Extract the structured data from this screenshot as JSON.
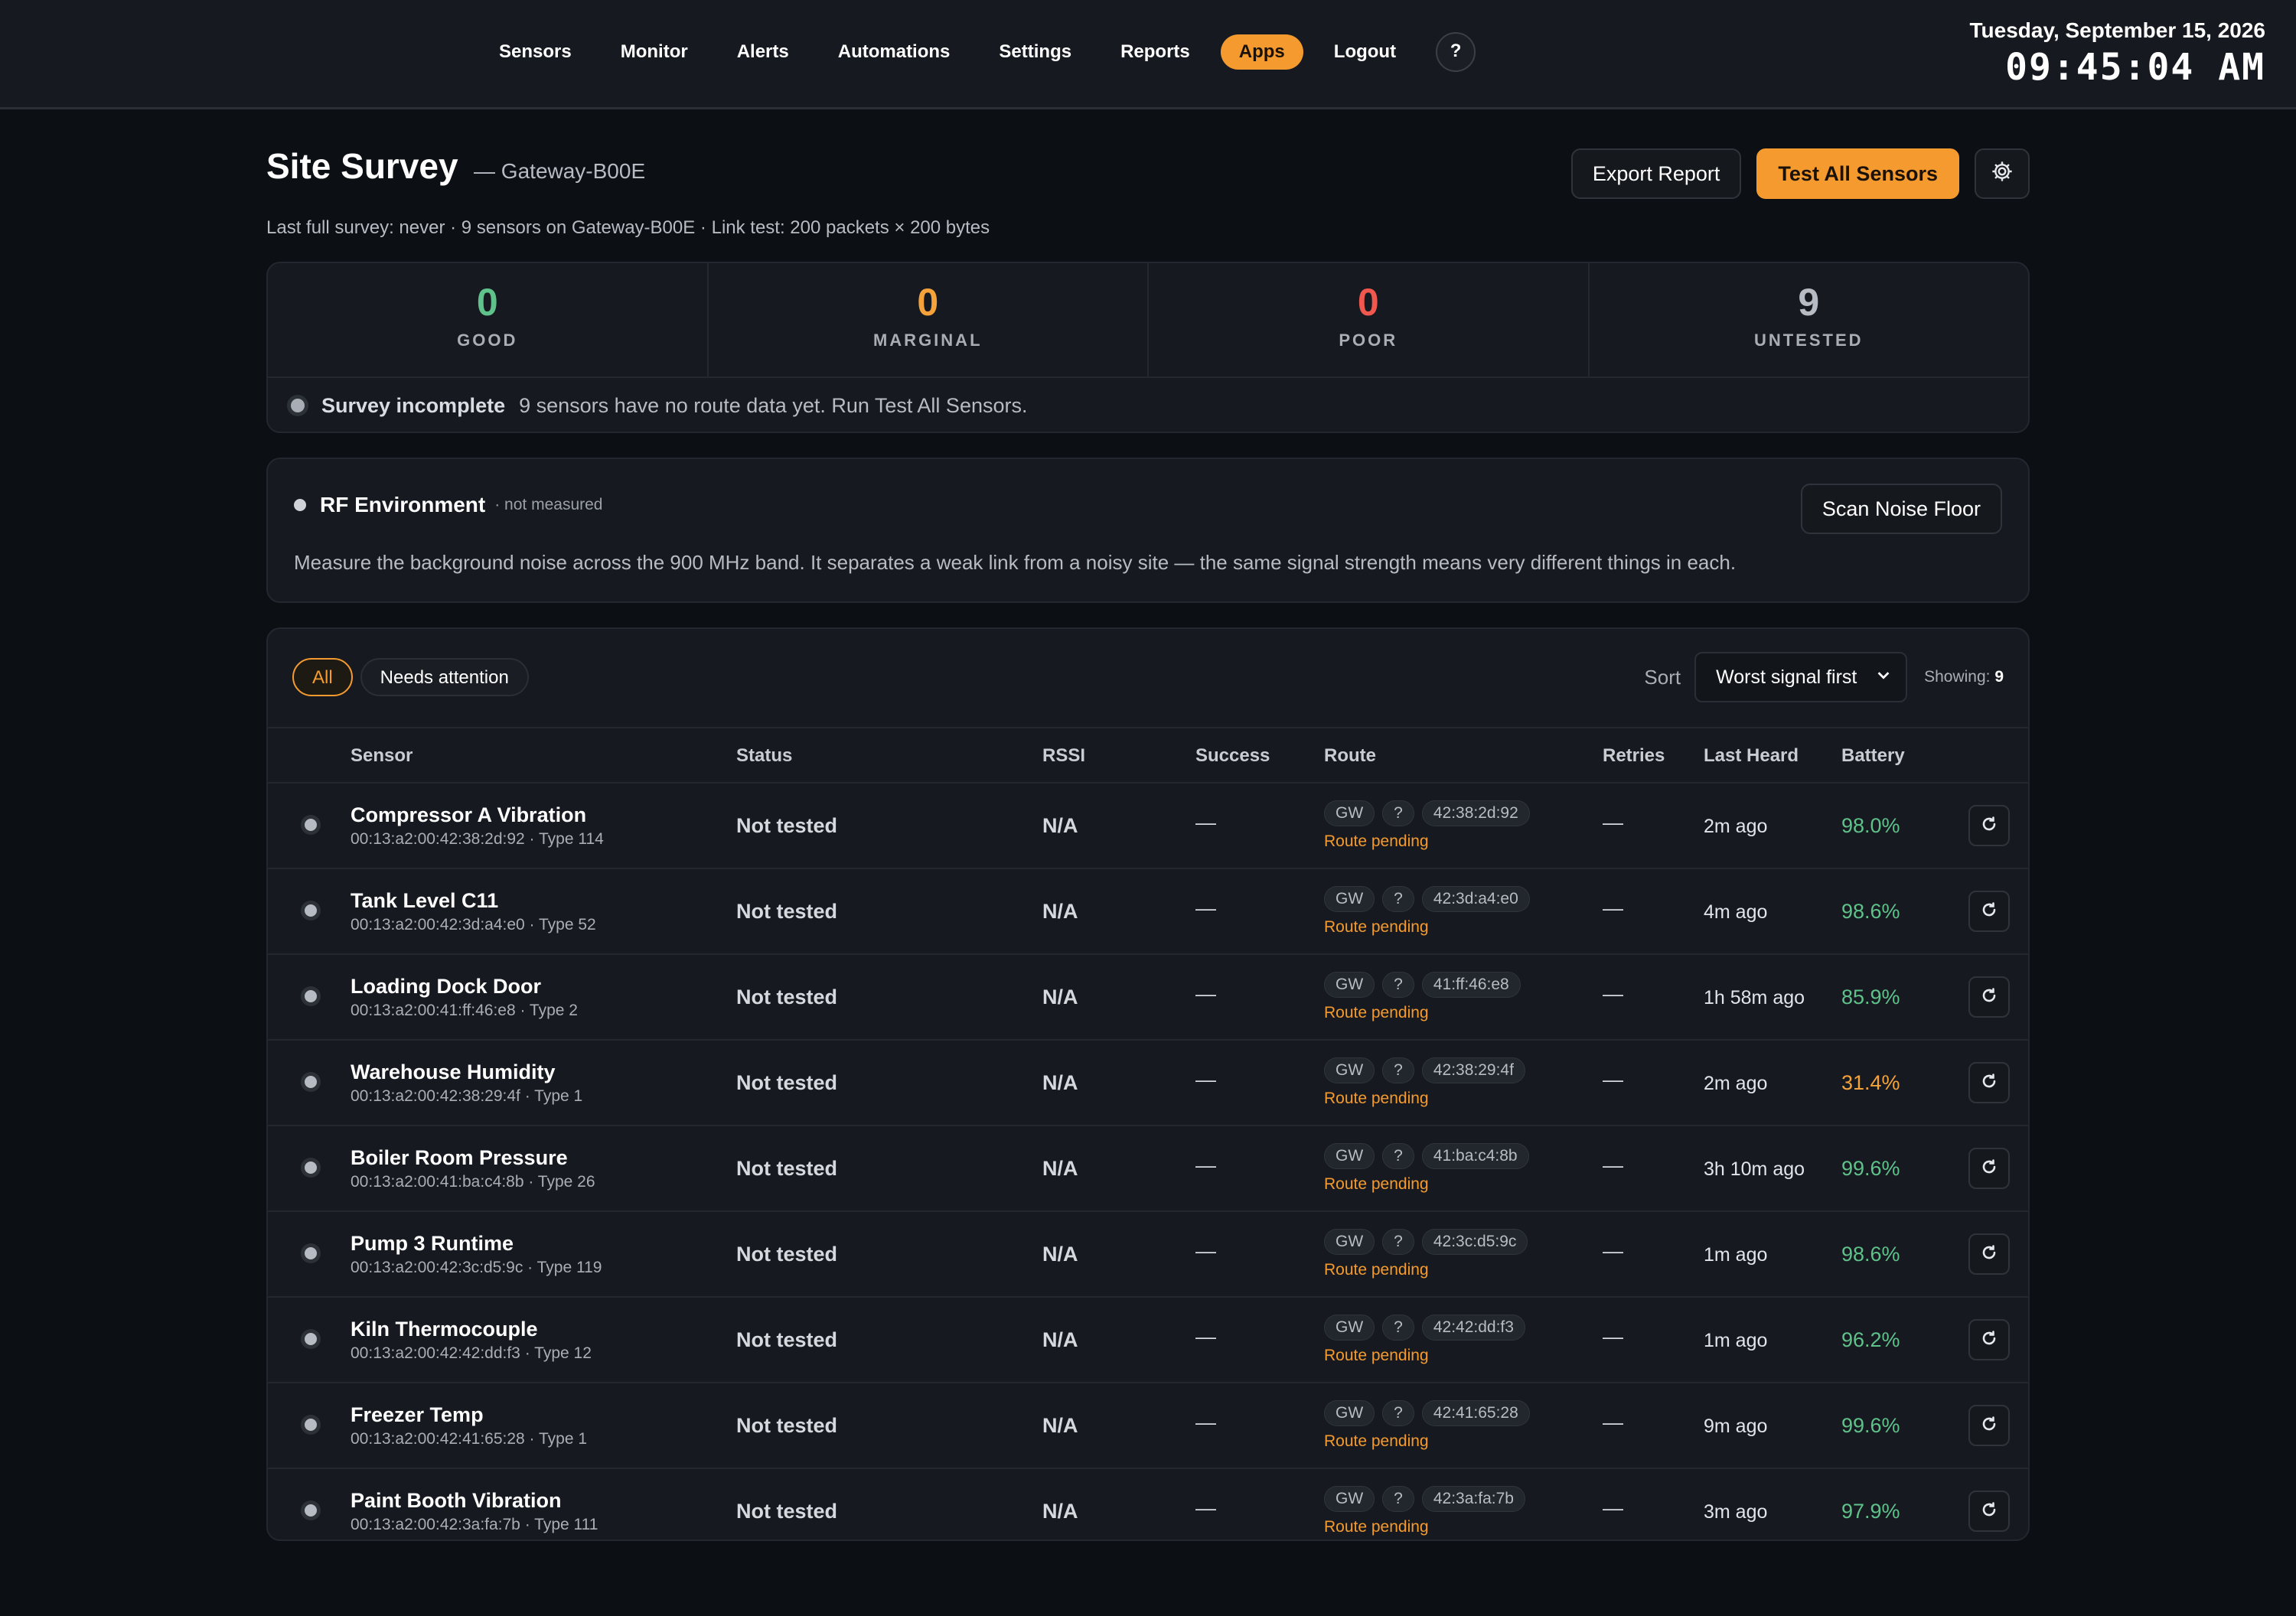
{
  "nav": {
    "items": [
      "Sensors",
      "Monitor",
      "Alerts",
      "Automations",
      "Settings",
      "Reports",
      "Apps",
      "Logout"
    ],
    "active": "Apps",
    "help_label": "?"
  },
  "clock": {
    "date": "Tuesday, September 15, 2026",
    "time": "09:45:04 AM"
  },
  "page": {
    "title": "Site Survey",
    "subtitle": "— Gateway-B00E",
    "meta": "Last full survey: never · 9 sensors on Gateway-B00E · Link test: 200 packets × 200 bytes",
    "export_label": "Export Report",
    "test_all_label": "Test All Sensors",
    "settings_icon": "gear-icon"
  },
  "stats": [
    {
      "value": "0",
      "label": "GOOD",
      "color": "#5fc28a"
    },
    {
      "value": "0",
      "label": "MARGINAL",
      "color": "#f5a23a"
    },
    {
      "value": "0",
      "label": "POOR",
      "color": "#f0584f"
    },
    {
      "value": "9",
      "label": "UNTESTED",
      "color": "#b7bcc4"
    }
  ],
  "survey": {
    "title": "Survey incomplete",
    "message": "9 sensors have no route data yet. Run Test All Sensors."
  },
  "rf": {
    "title": "RF Environment",
    "note": "· not measured",
    "button": "Scan Noise Floor",
    "description": "Measure the background noise across the 900 MHz band. It separates a weak link from a noisy site — the same signal strength means very different things in each."
  },
  "table": {
    "filters": [
      "All",
      "Needs attention"
    ],
    "active_filter": "All",
    "sort_label": "Sort",
    "sort_value": "Worst signal first",
    "showing_label": "Showing:",
    "showing_count": "9",
    "columns": [
      "Sensor",
      "Status",
      "RSSI",
      "Success",
      "Route",
      "Retries",
      "Last Heard",
      "Battery"
    ],
    "rows": [
      {
        "name": "Compressor A Vibration",
        "sub": "00:13:a2:00:42:38:2d:92 · Type 114",
        "status": "Not tested",
        "rssi": "N/A",
        "success": "—",
        "route": [
          "GW",
          "?",
          "42:38:2d:92"
        ],
        "route_note": "Route pending",
        "retries": "—",
        "heard": "2m ago",
        "battery": "98.0%",
        "battery_color": "#5fc28a"
      },
      {
        "name": "Tank Level C11",
        "sub": "00:13:a2:00:42:3d:a4:e0 · Type 52",
        "status": "Not tested",
        "rssi": "N/A",
        "success": "—",
        "route": [
          "GW",
          "?",
          "42:3d:a4:e0"
        ],
        "route_note": "Route pending",
        "retries": "—",
        "heard": "4m ago",
        "battery": "98.6%",
        "battery_color": "#5fc28a"
      },
      {
        "name": "Loading Dock Door",
        "sub": "00:13:a2:00:41:ff:46:e8 · Type 2",
        "status": "Not tested",
        "rssi": "N/A",
        "success": "—",
        "route": [
          "GW",
          "?",
          "41:ff:46:e8"
        ],
        "route_note": "Route pending",
        "retries": "—",
        "heard": "1h 58m ago",
        "battery": "85.9%",
        "battery_color": "#5fc28a"
      },
      {
        "name": "Warehouse Humidity",
        "sub": "00:13:a2:00:42:38:29:4f · Type 1",
        "status": "Not tested",
        "rssi": "N/A",
        "success": "—",
        "route": [
          "GW",
          "?",
          "42:38:29:4f"
        ],
        "route_note": "Route pending",
        "retries": "—",
        "heard": "2m ago",
        "battery": "31.4%",
        "battery_color": "#f5a23a"
      },
      {
        "name": "Boiler Room Pressure",
        "sub": "00:13:a2:00:41:ba:c4:8b · Type 26",
        "status": "Not tested",
        "rssi": "N/A",
        "success": "—",
        "route": [
          "GW",
          "?",
          "41:ba:c4:8b"
        ],
        "route_note": "Route pending",
        "retries": "—",
        "heard": "3h 10m ago",
        "battery": "99.6%",
        "battery_color": "#5fc28a"
      },
      {
        "name": "Pump 3 Runtime",
        "sub": "00:13:a2:00:42:3c:d5:9c · Type 119",
        "status": "Not tested",
        "rssi": "N/A",
        "success": "—",
        "route": [
          "GW",
          "?",
          "42:3c:d5:9c"
        ],
        "route_note": "Route pending",
        "retries": "—",
        "heard": "1m ago",
        "battery": "98.6%",
        "battery_color": "#5fc28a"
      },
      {
        "name": "Kiln Thermocouple",
        "sub": "00:13:a2:00:42:42:dd:f3 · Type 12",
        "status": "Not tested",
        "rssi": "N/A",
        "success": "—",
        "route": [
          "GW",
          "?",
          "42:42:dd:f3"
        ],
        "route_note": "Route pending",
        "retries": "—",
        "heard": "1m ago",
        "battery": "96.2%",
        "battery_color": "#5fc28a"
      },
      {
        "name": "Freezer Temp",
        "sub": "00:13:a2:00:42:41:65:28 · Type 1",
        "status": "Not tested",
        "rssi": "N/A",
        "success": "—",
        "route": [
          "GW",
          "?",
          "42:41:65:28"
        ],
        "route_note": "Route pending",
        "retries": "—",
        "heard": "9m ago",
        "battery": "99.6%",
        "battery_color": "#5fc28a"
      },
      {
        "name": "Paint Booth Vibration",
        "sub": "00:13:a2:00:42:3a:fa:7b · Type 111",
        "status": "Not tested",
        "rssi": "N/A",
        "success": "—",
        "route": [
          "GW",
          "?",
          "42:3a:fa:7b"
        ],
        "route_note": "Route pending",
        "retries": "—",
        "heard": "3m ago",
        "battery": "97.9%",
        "battery_color": "#5fc28a"
      }
    ]
  }
}
